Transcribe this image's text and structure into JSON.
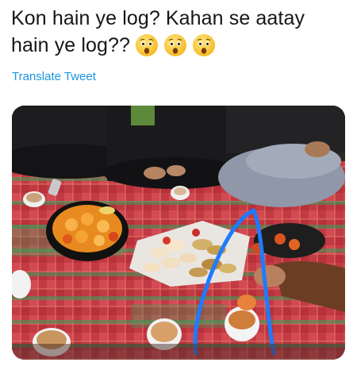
{
  "tweet": {
    "text_line1": "Kon hain ye log? Kahan se aatay",
    "text_line2": "hain ye log??",
    "emojis": [
      "astonished-face-emoji",
      "astonished-face-emoji",
      "astonished-face-emoji"
    ],
    "translate_label": "Translate Tweet"
  },
  "colors": {
    "link": "#1b95e0",
    "text": "#14171a",
    "annotation_circle": "#1e7bff"
  }
}
